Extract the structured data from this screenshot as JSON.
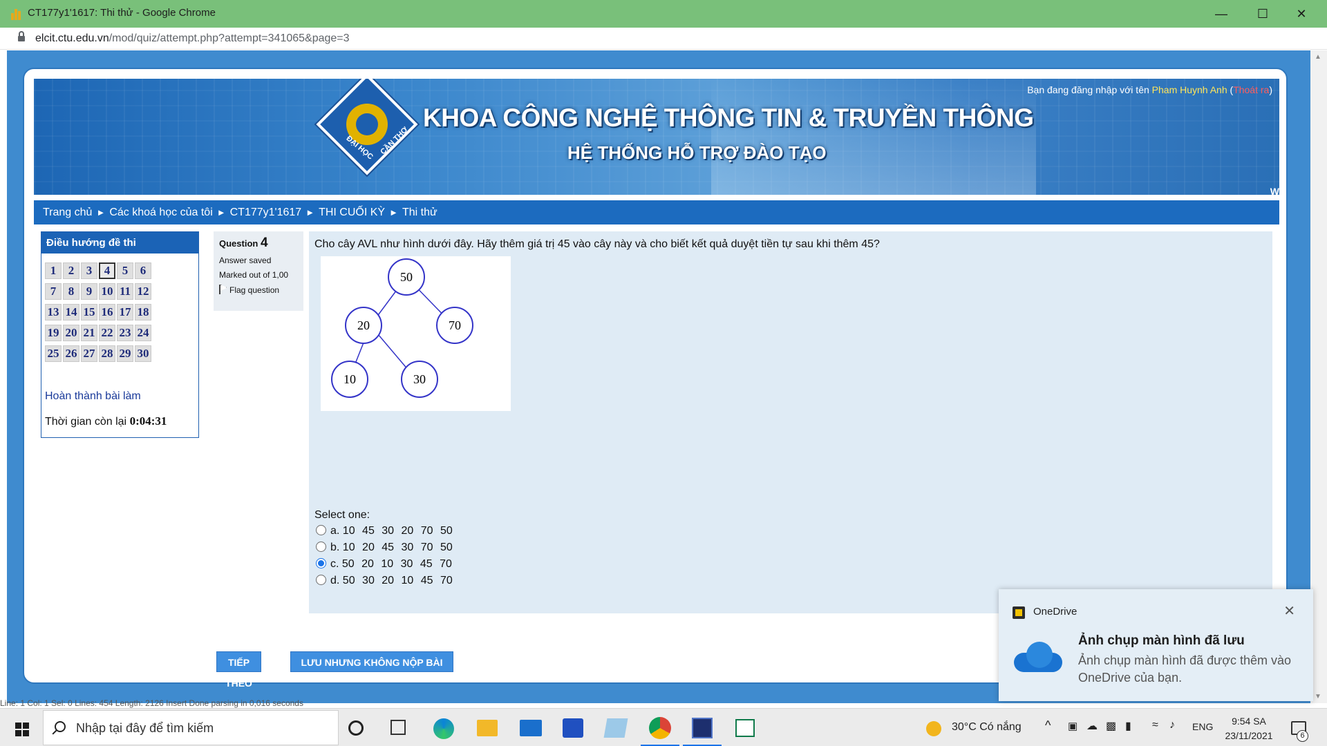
{
  "window": {
    "title": "CT177y1'1617: Thi thử - Google Chrome",
    "url_host": "elcit.ctu.edu.vn",
    "url_path": "/mod/quiz/attempt.php?attempt=341065&page=3"
  },
  "banner": {
    "title": "KHOA CÔNG NGHỆ THÔNG TIN & TRUYỀN THÔNG",
    "subtitle": "HỆ THỐNG HỖ TRỢ ĐÀO TẠO",
    "logo_top": "ĐẠI HỌC",
    "logo_side": "CẦN THƠ",
    "login_prefix": "Bạn đang đăng nhập với tên",
    "login_user": "Pham Huynh Anh",
    "logout": "Thoát ra",
    "edge_text": "W"
  },
  "breadcrumb": [
    "Trang chủ",
    "Các khoá học của tôi",
    "CT177y1'1617",
    "THI CUỐI KỲ",
    "Thi thử"
  ],
  "breadcrumb_separator": "►",
  "navigation": {
    "heading": "Điều hướng đề thi",
    "questions": [
      "1",
      "2",
      "3",
      "4",
      "5",
      "6",
      "7",
      "8",
      "9",
      "10",
      "11",
      "12",
      "13",
      "14",
      "15",
      "16",
      "17",
      "18",
      "19",
      "20",
      "21",
      "22",
      "23",
      "24",
      "25",
      "26",
      "27",
      "28",
      "29",
      "30"
    ],
    "current": "4",
    "finish_label": "Hoàn thành bài làm",
    "timer_label": "Thời gian còn lại",
    "timer_value": "0:04:31"
  },
  "question_info": {
    "label": "Question",
    "number": "4",
    "state": "Answer saved",
    "marks": "Marked out of 1,00",
    "flag": "Flag question"
  },
  "question": {
    "text": "Cho cây AVL như hình dưới đây. Hãy thêm giá trị 45 vào cây này và cho biết kết quả duyệt tiền tự sau khi thêm 45?",
    "tree_nodes": [
      "50",
      "20",
      "70",
      "10",
      "30"
    ],
    "select_label": "Select one:",
    "options": [
      {
        "letter": "a.",
        "value": "10 45 30 20 70 50",
        "checked": false
      },
      {
        "letter": "b.",
        "value": "10 20 45 30 70 50",
        "checked": false
      },
      {
        "letter": "c.",
        "value": "50 20 10 30 45 70",
        "checked": true
      },
      {
        "letter": "d.",
        "value": "50 30 20 10 45 70",
        "checked": false
      }
    ]
  },
  "buttons": {
    "next": "TIẾP THEO",
    "save": "LƯU NHƯNG KHÔNG NỘP BÀI"
  },
  "status_line": "Line:    1      Col:    1      Sel:    0      Lines:  454      Length:  2126      Insert      Done parsing in 0,016 seconds",
  "toast": {
    "app": "OneDrive",
    "title": "Ảnh chụp màn hình đã lưu",
    "message": "Ảnh chụp màn hình đã được thêm vào OneDrive của bạn."
  },
  "taskbar": {
    "search_placeholder": "Nhập tại đây để tìm kiếm",
    "weather": "30°C Có nắng",
    "lang": "ENG",
    "time": "9:54 SA",
    "date": "23/11/2021",
    "notifications": "6"
  },
  "colors": {
    "banner_blue": "#3a86cc",
    "breadcrumb": "#1c6bbf",
    "question_bg": "#dfebf5",
    "button": "#3f8fe0",
    "titlebar": "#79c07a"
  }
}
